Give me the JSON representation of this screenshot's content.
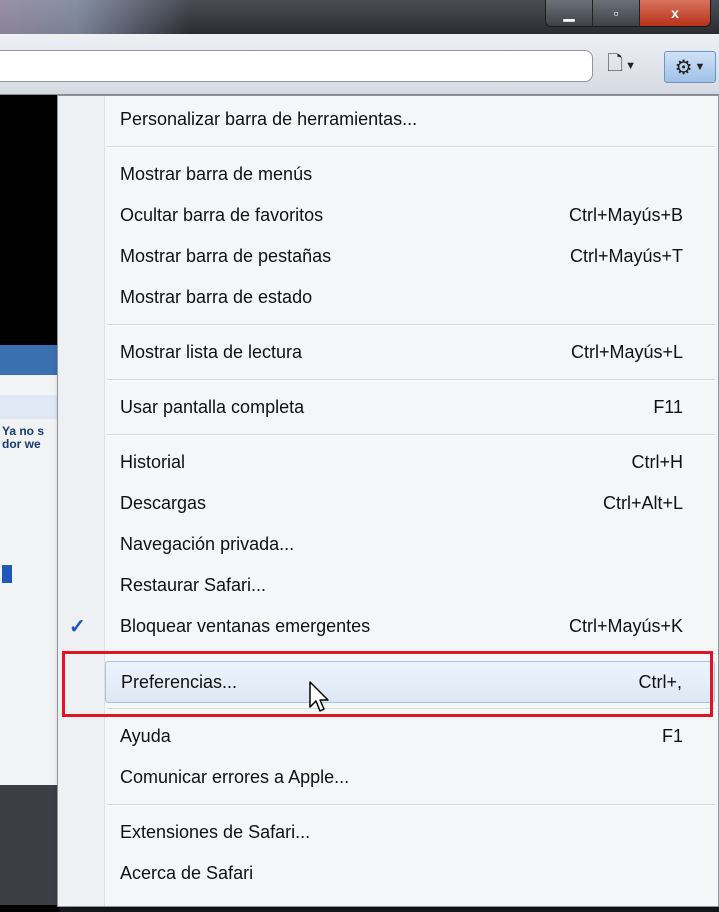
{
  "window": {
    "controls": [
      "minimize",
      "maximize",
      "close"
    ],
    "close_glyph": "x"
  },
  "toolbar": {
    "page_icon": "page-icon",
    "gear_icon": "gear-icon"
  },
  "menu": {
    "groups": [
      [
        {
          "label": "Personalizar barra de herramientas...",
          "shortcut": ""
        }
      ],
      [
        {
          "label": "Mostrar barra de menús",
          "shortcut": ""
        },
        {
          "label": "Ocultar barra de favoritos",
          "shortcut": "Ctrl+Mayús+B"
        },
        {
          "label": "Mostrar barra de pestañas",
          "shortcut": "Ctrl+Mayús+T"
        },
        {
          "label": "Mostrar barra de estado",
          "shortcut": ""
        }
      ],
      [
        {
          "label": "Mostrar lista de lectura",
          "shortcut": "Ctrl+Mayús+L"
        }
      ],
      [
        {
          "label": "Usar pantalla completa",
          "shortcut": "F11"
        }
      ],
      [
        {
          "label": "Historial",
          "shortcut": "Ctrl+H"
        },
        {
          "label": "Descargas",
          "shortcut": "Ctrl+Alt+L"
        },
        {
          "label": "Navegación privada...",
          "shortcut": ""
        },
        {
          "label": "Restaurar Safari...",
          "shortcut": ""
        },
        {
          "label": "Bloquear ventanas emergentes",
          "shortcut": "Ctrl+Mayús+K",
          "checked": true
        }
      ],
      [
        {
          "label": "Preferencias...",
          "shortcut": "Ctrl+,",
          "hovered": true
        }
      ],
      [
        {
          "label": "Ayuda",
          "shortcut": "F1"
        },
        {
          "label": "Comunicar errores a Apple...",
          "shortcut": ""
        }
      ],
      [
        {
          "label": "Extensiones de Safari...",
          "shortcut": ""
        },
        {
          "label": "Acerca de Safari",
          "shortcut": ""
        }
      ]
    ],
    "checkmark": "✓"
  },
  "background_page": {
    "fragment": "Ya no s\ndor we"
  },
  "colors": {
    "highlight": "#e2141f",
    "check": "#1e58c8"
  }
}
